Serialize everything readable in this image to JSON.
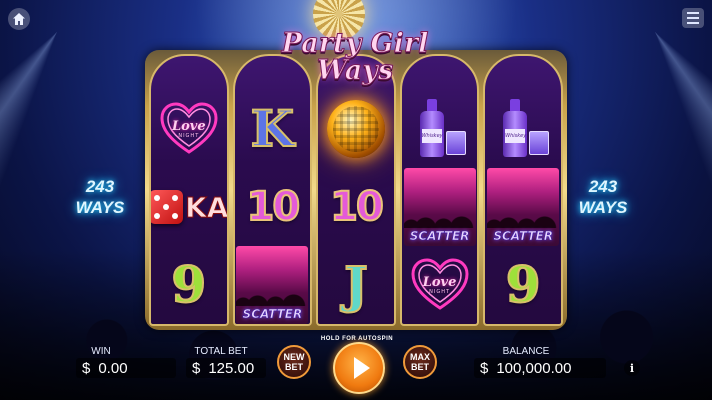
{
  "game": {
    "title_line1": "Party Girl",
    "title_line2": "Ways",
    "ways_left_num": "243",
    "ways_left_word": "WAYS",
    "ways_right_num": "243",
    "ways_right_word": "WAYS"
  },
  "nav": {
    "home_icon": "home-icon",
    "menu_icon": "hamburger-menu-icon"
  },
  "reels": [
    [
      "love-heart",
      "dice-ka",
      "9"
    ],
    [
      "K",
      "10",
      "scatter"
    ],
    [
      "disco-ball",
      "10",
      "J"
    ],
    [
      "whiskey",
      "scatter",
      "love-heart"
    ],
    [
      "whiskey",
      "scatter",
      "9"
    ]
  ],
  "symbols": {
    "heart_word": "Love",
    "heart_sub": "NIGHT",
    "whiskey_label": "Whiskey",
    "scatter_label": "SCATTER",
    "k": "K",
    "j": "J",
    "ten": "10",
    "nine": "9",
    "ka": "KA"
  },
  "bottom_bar": {
    "win_label": "WIN",
    "win_currency": "$",
    "win_value": "0.00",
    "total_bet_label": "TOTAL BET",
    "total_bet_currency": "$",
    "total_bet_value": "125.00",
    "new_bet_line1": "NEW",
    "new_bet_line2": "BET",
    "spin_hint": "HOLD FOR AUTOSPIN",
    "max_bet_line1": "MAX",
    "max_bet_line2": "BET",
    "balance_label": "BALANCE",
    "balance_currency": "$",
    "balance_value": "100,000.00",
    "info_label": "i"
  },
  "colors": {
    "accent_orange": "#f07a10",
    "frame_gold": "#c9a24a",
    "reel_purple": "#2a0b4e",
    "ways_glow": "#2ad8ff"
  }
}
